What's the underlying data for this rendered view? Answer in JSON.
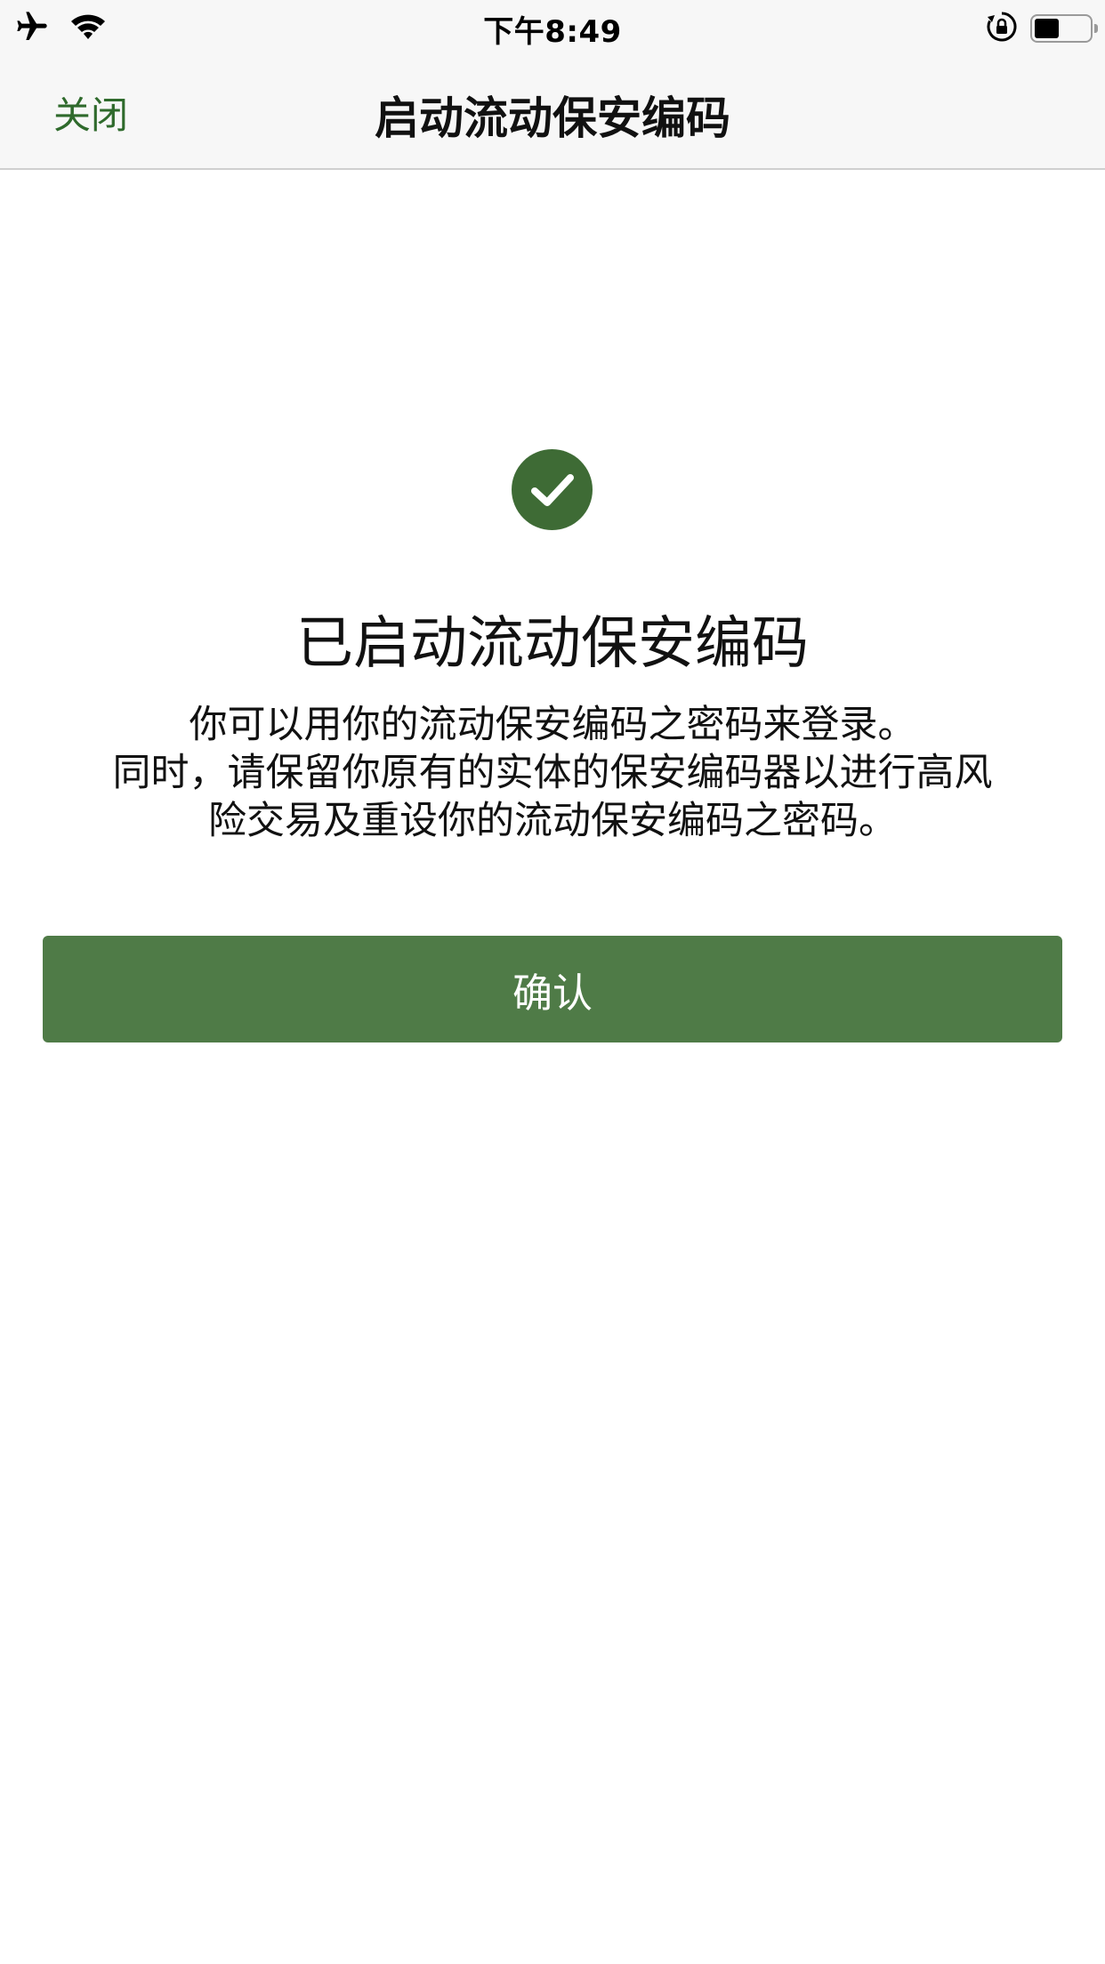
{
  "status_bar": {
    "time": "下午8:49",
    "battery_level": 0.45,
    "icons": [
      "airplane-icon",
      "wifi-icon",
      "orientation-lock-icon",
      "battery-icon"
    ]
  },
  "nav": {
    "close_label": "关闭",
    "title": "启动流动保安编码"
  },
  "content": {
    "headline": "已启动流动保安编码",
    "message_lines": [
      "你可以用你的流动保安编码之密码来登录。",
      "同时，请保留你原有的实体的保安编码器以进行高风",
      "险交易及重设你的流动保安编码之密码。"
    ],
    "confirm_label": "确认"
  },
  "colors": {
    "accent": "#2f6a2c",
    "success_icon": "#3e6b35",
    "button": "#4f7b47"
  }
}
